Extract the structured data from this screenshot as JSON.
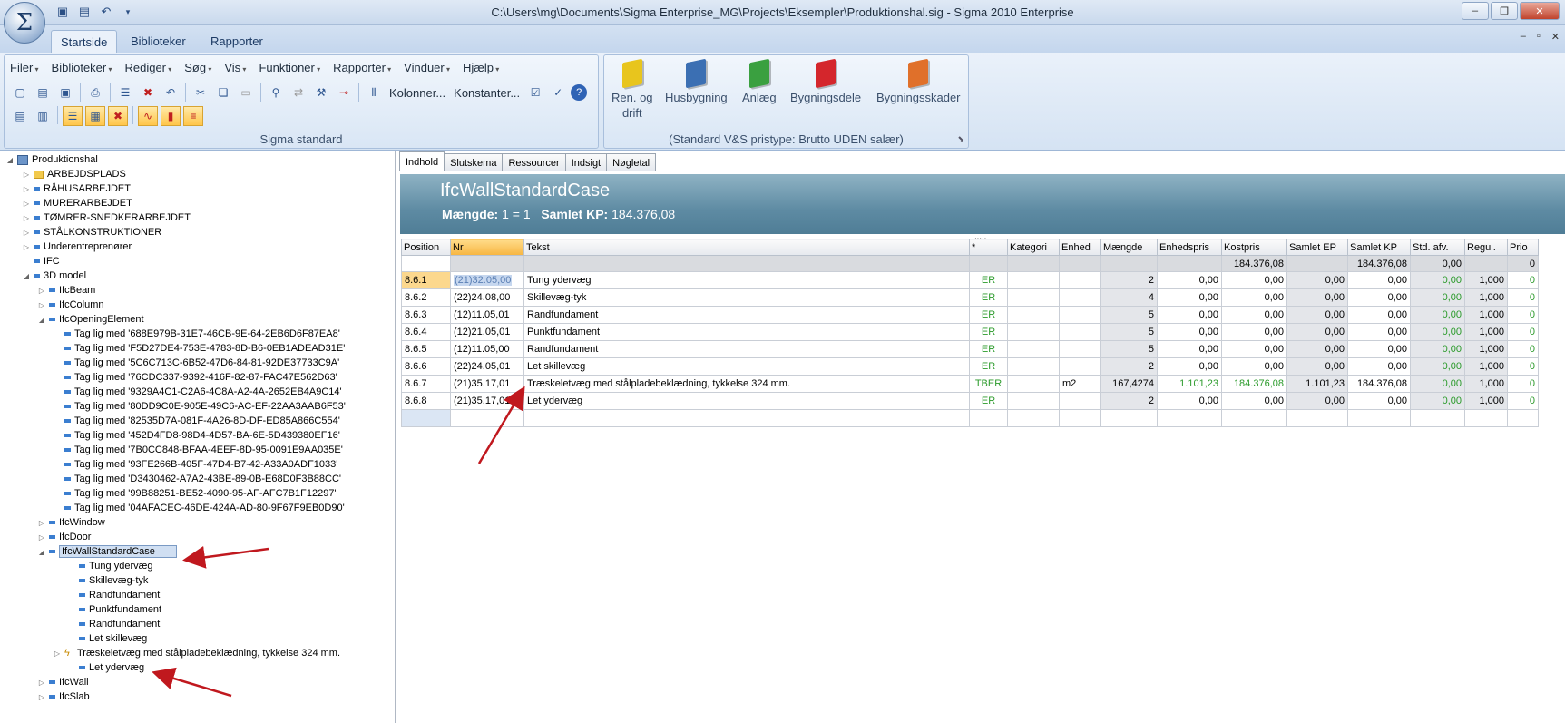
{
  "window": {
    "title": "C:\\Users\\mg\\Documents\\Sigma Enterprise_MG\\Projects\\Eksempler\\Produktionshal.sig - Sigma 2010 Enterprise",
    "app_symbol": "Σ"
  },
  "ribbon_tabs": [
    "Startside",
    "Biblioteker",
    "Rapporter"
  ],
  "menus": [
    "Filer",
    "Biblioteker",
    "Rediger",
    "Søg",
    "Vis",
    "Funktioner",
    "Rapporter",
    "Vinduer",
    "Hjælp"
  ],
  "toolbar": {
    "kolonner": "Kolonner...",
    "konstanter": "Konstanter...",
    "group1_label": "Sigma standard",
    "group2_label": "(Standard V&S pristype: Brutto UDEN salær)"
  },
  "libraries": [
    {
      "label1": "Ren. og",
      "label2": "drift",
      "color": "#e8c51d"
    },
    {
      "label1": "Husbygning",
      "label2": "",
      "color": "#3b6fb3"
    },
    {
      "label1": "Anlæg",
      "label2": "",
      "color": "#3aa040"
    },
    {
      "label1": "Bygningsdele",
      "label2": "",
      "color": "#d4262c"
    },
    {
      "label1": "Bygningsskader",
      "label2": "",
      "color": "#e0702a"
    }
  ],
  "tree": {
    "root": "Produktionshal",
    "top_items": [
      "ARBEJDSPLADS",
      "RÅHUSARBEJDET",
      "MURERARBEJDET",
      "TØMRER-SNEDKERARBEJDET",
      "STÅLKONSTRUKTIONER",
      "Underentreprenører",
      "IFC",
      "3D model"
    ],
    "model_items": {
      "beam": "IfcBeam",
      "column": "IfcColumn",
      "opening": "IfcOpeningElement",
      "window": "IfcWindow",
      "door": "IfcDoor",
      "wallstd": "IfcWallStandardCase",
      "wall": "IfcWall",
      "slab": "IfcSlab"
    },
    "opening_children": [
      "Tag lig med '688E979B-31E7-46CB-9E-64-2EB6D6F87EA8'",
      "Tag lig med 'F5D27DE4-753E-4783-8D-B6-0EB1ADEAD31E'",
      "Tag lig med '5C6C713C-6B52-47D6-84-81-92DE37733C9A'",
      "Tag lig med '76CDC337-9392-416F-82-87-FAC47E562D63'",
      "Tag lig med '9329A4C1-C2A6-4C8A-A2-4A-2652EB4A9C14'",
      "Tag lig med '80DD9C0E-905E-49C6-AC-EF-22AA3AAB6F53'",
      "Tag lig med '82535D7A-081F-4A26-8D-DF-ED85A866C554'",
      "Tag lig med '452D4FD8-98D4-4D57-BA-6E-5D439380EF16'",
      "Tag lig med '7B0CC848-BFAA-4EEF-8D-95-0091E9AA035E'",
      "Tag lig med '93FE266B-405F-47D4-B7-42-A33A0ADF1033'",
      "Tag lig med 'D3430462-A7A2-43BE-89-0B-E68D0F3B88CC'",
      "Tag lig med '99B88251-BE52-4090-95-AF-AFC7B1F12297'",
      "Tag lig med '04AFACEC-46DE-424A-AD-80-9F67F9EB0D90'"
    ],
    "wall_children": [
      "Tung ydervæg",
      "Skillevæg-tyk",
      "Randfundament",
      "Punktfundament",
      "Randfundament",
      "Let skillevæg",
      "Træskeletvæg med stålpladebeklædning, tykkelse 324 mm.",
      "Let ydervæg"
    ]
  },
  "panel_tabs": [
    "Indhold",
    "Slutskema",
    "Ressourcer",
    "Indsigt",
    "Nøgletal"
  ],
  "header": {
    "title": "IfcWallStandardCase",
    "qty_label": "Mængde:",
    "qty_value": "1 = 1",
    "kp_label": "Samlet KP:",
    "kp_value": "184.376,08"
  },
  "grid": {
    "columns": [
      "Position",
      "Nr",
      "Tekst",
      "*",
      "Kategori",
      "Enhed",
      "Mængde",
      "Enhedspris",
      "Kostpris",
      "Samlet EP",
      "Samlet KP",
      "Std. afv.",
      "Regul.",
      "Prio"
    ],
    "totals": {
      "kostpris": "184.376,08",
      "samlet_kp": "184.376,08",
      "std": "0,00",
      "prio": "0"
    },
    "rows": [
      {
        "pos": "8.6.1",
        "nr": "(21)32.05,00",
        "tekst": "Tung ydervæg",
        "star": "ER",
        "kat": "",
        "enhed": "",
        "mgd": "2",
        "ep": "0,00",
        "kp": "0,00",
        "sep": "0,00",
        "skp": "0,00",
        "std": "0,00",
        "regul": "1,000",
        "prio": "0"
      },
      {
        "pos": "8.6.2",
        "nr": "(22)24.08,00",
        "tekst": "Skillevæg-tyk",
        "star": "ER",
        "kat": "",
        "enhed": "",
        "mgd": "4",
        "ep": "0,00",
        "kp": "0,00",
        "sep": "0,00",
        "skp": "0,00",
        "std": "0,00",
        "regul": "1,000",
        "prio": "0"
      },
      {
        "pos": "8.6.3",
        "nr": "(12)11.05,01",
        "tekst": "Randfundament",
        "star": "ER",
        "kat": "",
        "enhed": "",
        "mgd": "5",
        "ep": "0,00",
        "kp": "0,00",
        "sep": "0,00",
        "skp": "0,00",
        "std": "0,00",
        "regul": "1,000",
        "prio": "0"
      },
      {
        "pos": "8.6.4",
        "nr": "(12)21.05,01",
        "tekst": "Punktfundament",
        "star": "ER",
        "kat": "",
        "enhed": "",
        "mgd": "5",
        "ep": "0,00",
        "kp": "0,00",
        "sep": "0,00",
        "skp": "0,00",
        "std": "0,00",
        "regul": "1,000",
        "prio": "0"
      },
      {
        "pos": "8.6.5",
        "nr": "(12)11.05,00",
        "tekst": "Randfundament",
        "star": "ER",
        "kat": "",
        "enhed": "",
        "mgd": "5",
        "ep": "0,00",
        "kp": "0,00",
        "sep": "0,00",
        "skp": "0,00",
        "std": "0,00",
        "regul": "1,000",
        "prio": "0"
      },
      {
        "pos": "8.6.6",
        "nr": "(22)24.05,01",
        "tekst": "Let skillevæg",
        "star": "ER",
        "kat": "",
        "enhed": "",
        "mgd": "2",
        "ep": "0,00",
        "kp": "0,00",
        "sep": "0,00",
        "skp": "0,00",
        "std": "0,00",
        "regul": "1,000",
        "prio": "0"
      },
      {
        "pos": "8.6.7",
        "nr": "(21)35.17,01",
        "tekst": "Træskeletvæg med stålpladebeklædning, tykkelse 324 mm.",
        "star": "TBER",
        "kat": "",
        "enhed": "m2",
        "mgd": "167,4274",
        "ep": "1.101,23",
        "kp": "184.376,08",
        "sep": "1.101,23",
        "skp": "184.376,08",
        "std": "0,00",
        "regul": "1,000",
        "prio": "0"
      },
      {
        "pos": "8.6.8",
        "nr": "(21)35.17,01",
        "tekst": "Let ydervæg",
        "star": "ER",
        "kat": "",
        "enhed": "",
        "mgd": "2",
        "ep": "0,00",
        "kp": "0,00",
        "sep": "0,00",
        "skp": "0,00",
        "std": "0,00",
        "regul": "1,000",
        "prio": "0"
      }
    ]
  },
  "colors": {
    "accent_green": "#2a9a2a",
    "header_band": "#5e8ba3",
    "selection": "#fcd88e",
    "annotation_arrow": "#c0181e"
  }
}
